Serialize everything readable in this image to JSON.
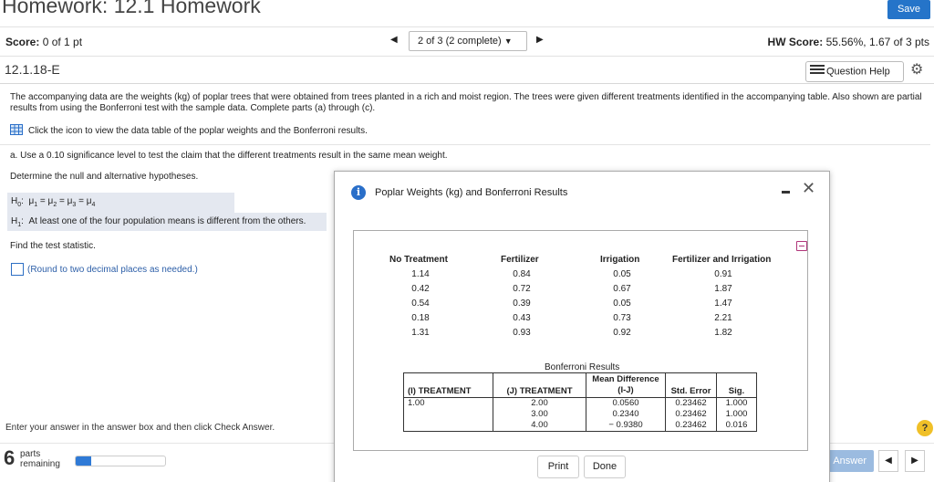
{
  "header": {
    "title": "Homework: 12.1 Homework",
    "save_label": "Save"
  },
  "scorebar": {
    "score_label": "Score:",
    "score_value": "0 of 1 pt",
    "question_select": "2 of 3 (2 complete)",
    "hw_score_label": "HW Score:",
    "hw_score_value": "55.56%, 1.67 of 3 pts"
  },
  "question": {
    "id": "12.1.18-E",
    "help_label": "Question Help"
  },
  "content": {
    "intro": "The accompanying data are the weights (kg) of poplar trees that were obtained from trees planted in a rich and moist region. The trees were given different treatments identified in the accompanying table. Also shown are partial results from using the Bonferroni test with the sample data. Complete parts (a) through (c).",
    "table_link": "Click the icon to view the data table of the poplar weights and the Bonferroni results.",
    "part_a": "a. Use a 0.10 significance level to test the claim that the different treatments result in the same mean weight.",
    "hyp_prompt": "Determine the null and alternative hypotheses.",
    "h1_text": "At least one of the four population means is different from the others.",
    "find_stat": "Find the test statistic.",
    "round_note": "(Round to two decimal places as needed.)",
    "enter_answer": "Enter your answer in the answer box and then click Check Answer."
  },
  "footer": {
    "parts_count": "6",
    "parts_label_1": "parts",
    "parts_label_2": "remaining",
    "progress": 0.17,
    "check_answer": "Answer"
  },
  "popup": {
    "title": "Poplar Weights (kg) and Bonferroni Results",
    "columns": [
      "No Treatment",
      "Fertilizer",
      "Irrigation",
      "Fertilizer and Irrigation"
    ],
    "rows": [
      [
        "1.14",
        "0.84",
        "0.05",
        "0.91"
      ],
      [
        "0.42",
        "0.72",
        "0.67",
        "1.87"
      ],
      [
        "0.54",
        "0.39",
        "0.05",
        "1.47"
      ],
      [
        "0.18",
        "0.43",
        "0.73",
        "2.21"
      ],
      [
        "1.31",
        "0.93",
        "0.92",
        "1.82"
      ]
    ],
    "bonferroni_title": "Bonferroni Results",
    "bf_headers": [
      "(I) TREATMENT",
      "(J) TREATMENT",
      "Mean Difference (I-J)",
      "Std. Error",
      "Sig."
    ],
    "bf_i": "1.00",
    "bf_j": [
      "2.00",
      "3.00",
      "4.00"
    ],
    "bf_mean": [
      "0.0560",
      "0.2340",
      "− 0.9380"
    ],
    "bf_se": [
      "0.23462",
      "0.23462",
      "0.23462"
    ],
    "bf_sig": [
      "1.000",
      "1.000",
      "0.016"
    ],
    "print_label": "Print",
    "done_label": "Done"
  },
  "colors": {
    "accent": "#2574c9",
    "highlight": "#e4e8f0",
    "help": "#f0c028"
  }
}
